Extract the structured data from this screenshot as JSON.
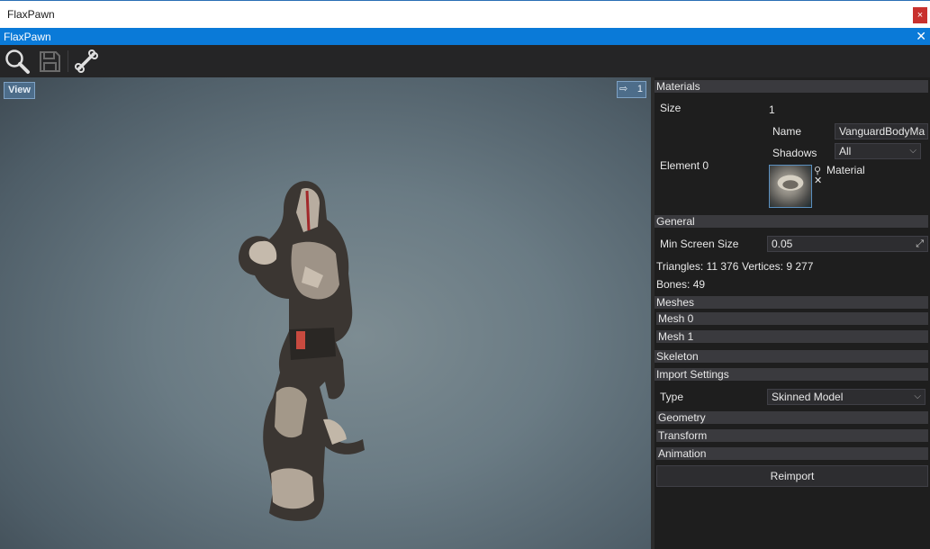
{
  "window": {
    "title": "FlaxPawn",
    "close_glyph": "×"
  },
  "tab": {
    "label": "FlaxPawn",
    "close_glyph": "✕"
  },
  "toolbar": {
    "icons": [
      "search-icon",
      "save-icon",
      "bone-icon"
    ]
  },
  "viewport": {
    "view_button": "View",
    "camera_speed": "1"
  },
  "materials": {
    "header": "Materials",
    "size_label": "Size",
    "size_value": "1",
    "element_label": "Element 0",
    "name_label": "Name",
    "name_value": "VanguardBodyMa",
    "shadows_label": "Shadows",
    "shadows_value": "All",
    "material_label": "Material",
    "remove_glyph": "✕"
  },
  "general": {
    "header": "General",
    "min_screen_size_label": "Min Screen Size",
    "min_screen_size_value": "0.05",
    "triangles_text": "Triangles: 11 376",
    "vertices_text": "Vertices: 9 277",
    "bones_text": "Bones: 49"
  },
  "meshes": {
    "header": "Meshes",
    "items": [
      "Mesh 0",
      "Mesh 1"
    ]
  },
  "skeleton": {
    "header": "Skeleton"
  },
  "import_settings": {
    "header": "Import Settings",
    "type_label": "Type",
    "type_value": "Skinned Model",
    "groups": [
      "Geometry",
      "Transform",
      "Animation"
    ],
    "reimport_label": "Reimport"
  },
  "colors": {
    "accent": "#0a7ad8",
    "close_red": "#c8312e",
    "panel_bg": "#1e1e1e",
    "header_bg": "#3a3a3e"
  }
}
